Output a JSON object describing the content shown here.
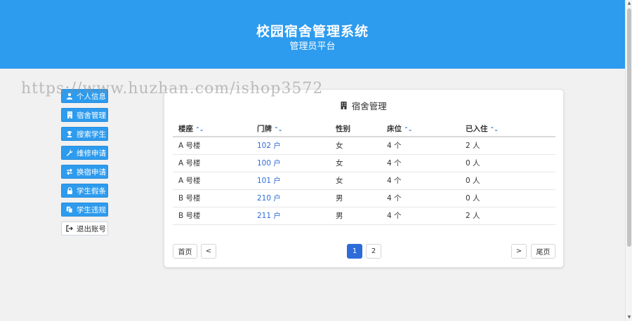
{
  "header": {
    "title": "校园宿舍管理系统",
    "subtitle": "管理员平台"
  },
  "watermark": "https://www.huzhan.com/ishop3572",
  "sidebar": {
    "items": [
      {
        "label": "个人信息",
        "icon": "user-icon"
      },
      {
        "label": "宿舍管理",
        "icon": "building-icon"
      },
      {
        "label": "搜索学生",
        "icon": "student-icon"
      },
      {
        "label": "维修申请",
        "icon": "wrench-icon"
      },
      {
        "label": "换宿申请",
        "icon": "swap-icon"
      },
      {
        "label": "学生假条",
        "icon": "lock-icon"
      },
      {
        "label": "学生违规",
        "icon": "copy-icon"
      },
      {
        "label": "退出账号",
        "icon": "logout-icon"
      }
    ]
  },
  "panel": {
    "title": "宿舍管理",
    "columns": [
      "楼座",
      "门牌",
      "性别",
      "床位",
      "已入住"
    ],
    "rows": [
      [
        "A 号楼",
        "102 户",
        "女",
        "4 个",
        "2 人"
      ],
      [
        "A 号楼",
        "100 户",
        "女",
        "4 个",
        "0 人"
      ],
      [
        "A 号楼",
        "101 户",
        "女",
        "4 个",
        "0 人"
      ],
      [
        "B 号楼",
        "210 户",
        "男",
        "4 个",
        "0 人"
      ],
      [
        "B 号楼",
        "211 户",
        "男",
        "4 个",
        "2 人"
      ]
    ]
  },
  "pager": {
    "first": "首页",
    "prev": "<",
    "pages": [
      "1",
      "2"
    ],
    "current": "1",
    "next": ">",
    "last": "尾页"
  },
  "colors": {
    "primary": "#2d9bee",
    "link": "#2d6bd8"
  }
}
